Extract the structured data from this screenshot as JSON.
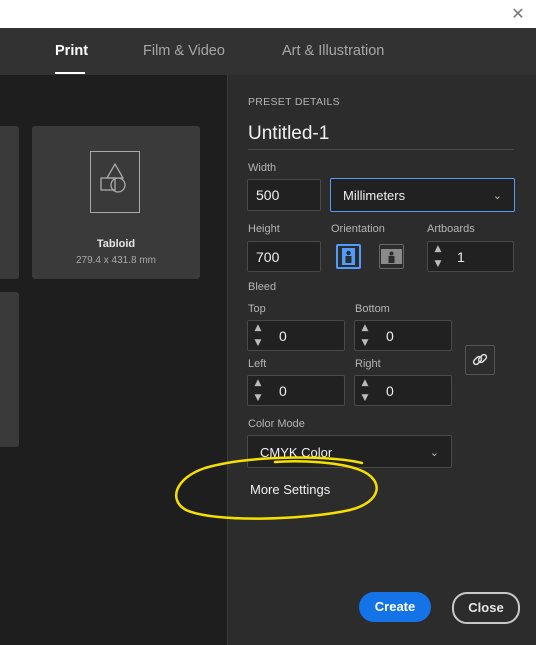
{
  "tabs": [
    {
      "label": "Print",
      "active": true
    },
    {
      "label": "Film & Video",
      "active": false
    },
    {
      "label": "Art & Illustration",
      "active": false
    }
  ],
  "presets": [
    {
      "title": "Tabloid",
      "size": "279.4 x 431.8 mm"
    }
  ],
  "details": {
    "section_title": "PRESET DETAILS",
    "name": "Untitled-1",
    "width_label": "Width",
    "width_value": "500",
    "units": "Millimeters",
    "height_label": "Height",
    "height_value": "700",
    "orientation_label": "Orientation",
    "artboards_label": "Artboards",
    "artboards_value": "1",
    "bleed_label": "Bleed",
    "top_label": "Top",
    "top_value": "0",
    "bottom_label": "Bottom",
    "bottom_value": "0",
    "left_label": "Left",
    "left_value": "0",
    "right_label": "Right",
    "right_value": "0",
    "color_mode_label": "Color Mode",
    "color_mode_value": "CMYK Color",
    "more_settings": "More Settings"
  },
  "buttons": {
    "create": "Create",
    "close": "Close"
  },
  "colors": {
    "accent": "#1473e6",
    "annotation": "#f5e000"
  },
  "icons": {
    "window_close": "✕",
    "chevron": "⌄",
    "step_up": "▲",
    "step_down": "▼"
  }
}
